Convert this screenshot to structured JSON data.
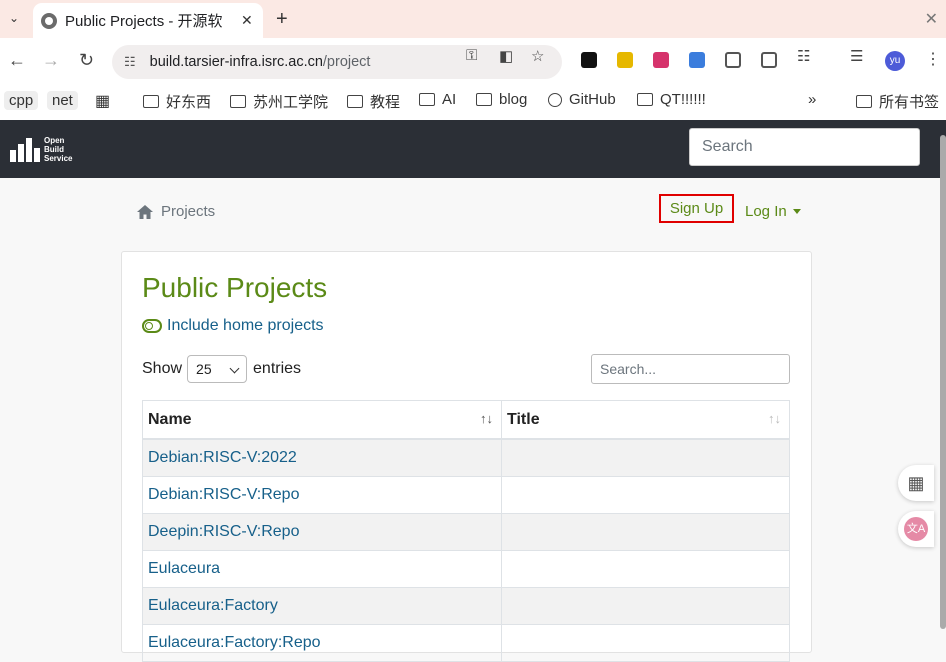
{
  "browser": {
    "tab_title": "Public Projects - 开源软",
    "url_host": "build.tarsier-infra.isrc.ac.cn",
    "url_path": "/project",
    "bookmarks": [
      "cpp",
      "net",
      "好东西",
      "苏州工学院",
      "教程",
      "AI",
      "blog",
      "GitHub",
      "QT!!!!!!",
      "所有书签"
    ],
    "avatar_text": "yu"
  },
  "obs": {
    "logo_lines": [
      "Open",
      "Build",
      "Service"
    ],
    "search_placeholder": "Search"
  },
  "nav": {
    "breadcrumb": "Projects",
    "signup": "Sign Up",
    "login": "Log In"
  },
  "main": {
    "title": "Public Projects",
    "include_home": "Include home projects",
    "show_label": "Show",
    "entries_value": "25",
    "entries_label": "entries",
    "table_search_placeholder": "Search...",
    "columns": [
      "Name",
      "Title"
    ],
    "rows": [
      {
        "name": "Debian:RISC-V:2022",
        "title": ""
      },
      {
        "name": "Debian:RISC-V:Repo",
        "title": ""
      },
      {
        "name": "Deepin:RISC-V:Repo",
        "title": ""
      },
      {
        "name": "Eulaceura",
        "title": ""
      },
      {
        "name": "Eulaceura:Factory",
        "title": ""
      },
      {
        "name": "Eulaceura:Factory:Repo",
        "title": ""
      }
    ]
  },
  "colors": {
    "obs_header": "#2b2f36",
    "accent_green": "#5b8a17",
    "link_blue": "#17608a",
    "highlight_red": "#e00000"
  }
}
